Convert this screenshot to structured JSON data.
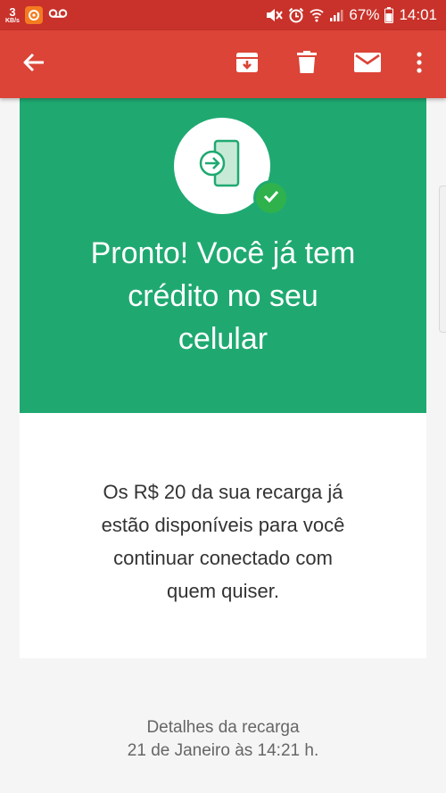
{
  "status_bar": {
    "net_speed_value": "3",
    "net_speed_unit": "KB/s",
    "battery": "67%",
    "time": "14:01",
    "icons": [
      "app-notification-icon",
      "voicemail-icon",
      "mute-icon",
      "alarm-icon",
      "wifi-icon",
      "signal-icon",
      "battery-icon"
    ]
  },
  "toolbar": {
    "actions": [
      "back-arrow-icon",
      "archive-icon",
      "delete-icon",
      "mark-unread-icon",
      "more-options-icon"
    ]
  },
  "hero": {
    "title_lines": [
      "Pronto! Você já tem",
      "crédito no seu",
      "celular"
    ],
    "icons": [
      "phone-recharge-icon",
      "check-icon"
    ]
  },
  "message": {
    "lines": [
      "Os R$ 20 da sua recarga já",
      "estão disponíveis para você",
      "continuar conectado com",
      "quem quiser."
    ]
  },
  "details": {
    "title": "Detalhes da recarga",
    "date": "21 de Janeiro às 14:21 h."
  },
  "colors": {
    "status_bar": "#c8322a",
    "toolbar": "#db4437",
    "hero": "#1fa971",
    "check_badge": "#2fb24c"
  }
}
